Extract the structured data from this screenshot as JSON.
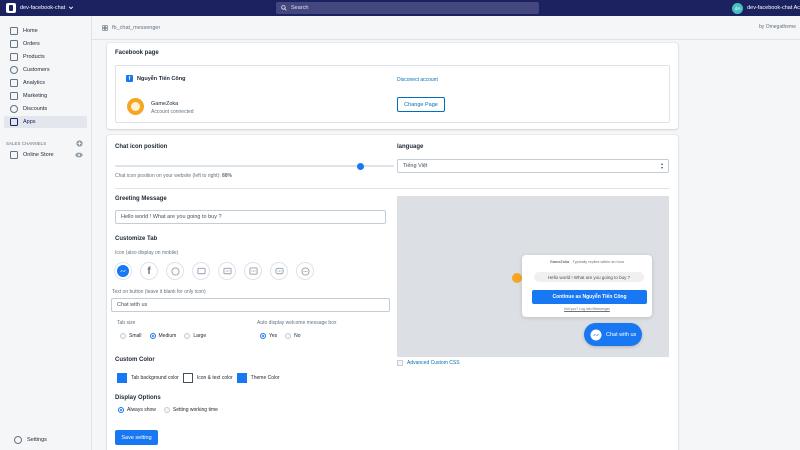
{
  "topbar": {
    "store_name": "dev-facebook-chat",
    "search_placeholder": "Search",
    "avatar_initials": "dA",
    "account_name": "dev-facebook-chat Ac"
  },
  "sidebar": {
    "items": [
      {
        "label": "Home",
        "icon": "home-icon"
      },
      {
        "label": "Orders",
        "icon": "orders-icon"
      },
      {
        "label": "Products",
        "icon": "products-icon"
      },
      {
        "label": "Customers",
        "icon": "customers-icon"
      },
      {
        "label": "Analytics",
        "icon": "analytics-icon"
      },
      {
        "label": "Marketing",
        "icon": "marketing-icon"
      },
      {
        "label": "Discounts",
        "icon": "discounts-icon"
      },
      {
        "label": "Apps",
        "icon": "apps-icon"
      }
    ],
    "sales_channels_label": "SALES CHANNELS",
    "online_store_label": "Online Store",
    "settings_label": "Settings"
  },
  "header": {
    "breadcrumb": "fb_chat_messenger",
    "by_label": "by Omegatheme"
  },
  "facebook_page": {
    "title": "Facebook page",
    "owner_name": "Nguyễn Tiến Công",
    "disconnect_label": "Disconect account",
    "page_name": "GameZoka",
    "page_status": "Account connected",
    "change_page_label": "Change Page"
  },
  "settings": {
    "chat_icon_position_label": "Chat icon position",
    "position_desc_prefix": "Chat icon position on your website (left to right): ",
    "position_value": "88%",
    "position_fraction": 0.88,
    "language_label": "language",
    "language_value": "Tiếng Việt",
    "greeting_label": "Greeting Message",
    "greeting_value": "Hello world ! What are you going to buy ?",
    "customize_tab_label": "Customize Tab",
    "icon_caption": "Icon (also display on mobile)",
    "text_on_button_label": "Text on button (leave it blank for only icon)",
    "text_on_button_value": "Chat with us",
    "tab_size_label": "Tab size",
    "tab_size_options": [
      "Small",
      "Medium",
      "Large"
    ],
    "auto_display_label": "Auto display welcome message box",
    "auto_display_options": [
      "Yes",
      "No"
    ],
    "custom_color_label": "Custom Color",
    "tab_bg_color_label": "Tab background color",
    "icon_text_color_label": "Icon & text color",
    "theme_color_label": "Theme Color",
    "colors": {
      "tab_bg": "#1877f2",
      "icon_text": "#ffffff",
      "theme": "#1877f2"
    },
    "display_options_label": "Display Options",
    "display_options": [
      "Always show",
      "Setting working time"
    ],
    "save_label": "Save setting",
    "advanced_css_label": "Advanced Custom CSS"
  },
  "preview": {
    "reply_time_prefix": "GameZoka",
    "reply_time": " · Typically replies within an hour",
    "greeting": "Hello world ! What are you going to buy ?",
    "continue_label": "Continue as Nguyễn Tiến Công",
    "not_you_label": "Not you? Log into Messenger",
    "chat_button_label": "Chat with us"
  }
}
